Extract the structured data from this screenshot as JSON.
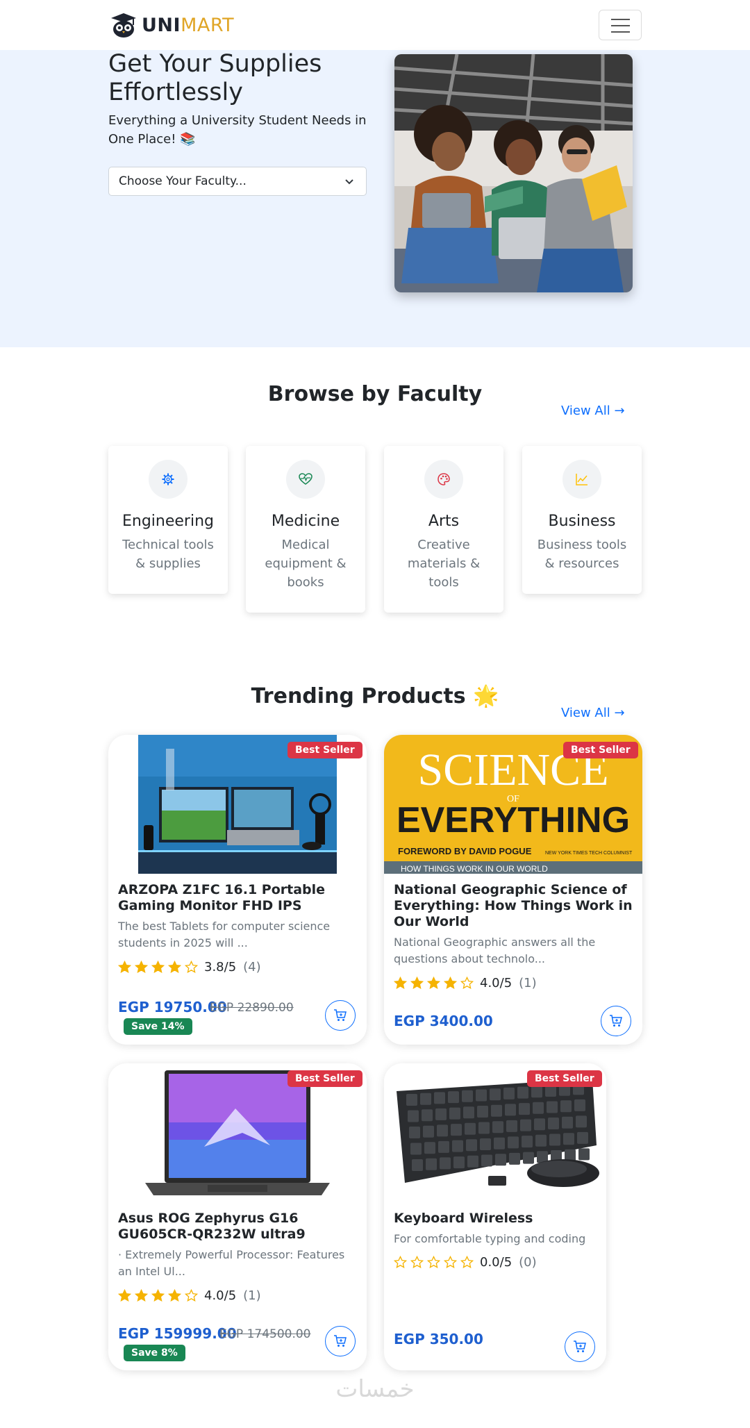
{
  "brand": {
    "part1": "UNI",
    "part2": "MART"
  },
  "hero": {
    "title": "Get Your Supplies Effortlessly",
    "subtitle": "Everything a University Student Needs in One Place! 📚",
    "faculty_select": "Choose Your Faculty..."
  },
  "faculty_section": {
    "title": "Browse by Faculty",
    "view_all": "View All →",
    "items": [
      {
        "name": "Engineering",
        "desc": "Technical tools & supplies",
        "icon": "gear-icon",
        "color": "#0d6efd"
      },
      {
        "name": "Medicine",
        "desc": "Medical equipment & books",
        "icon": "heart-pulse-icon",
        "color": "#198754"
      },
      {
        "name": "Arts",
        "desc": "Creative materials & tools",
        "icon": "palette-icon",
        "color": "#dc3545"
      },
      {
        "name": "Business",
        "desc": "Business tools & resources",
        "icon": "chart-line-icon",
        "color": "#ffc107"
      }
    ]
  },
  "trending": {
    "title": "Trending Products 🌟",
    "view_all": "View All →",
    "products": [
      {
        "badge": "Best Seller",
        "title": "ARZOPA Z1FC 16.1 Portable Gaming Monitor FHD IPS",
        "desc": "The best Tablets for computer science students in 2025 will ...",
        "rating": "3.8/5",
        "rating_value": 3.8,
        "count": "(4)",
        "price": "EGP 19750.00",
        "old_price": "EGP 22890.00",
        "save": "Save 14%"
      },
      {
        "badge": "Best Seller",
        "title": "National Geographic Science of Everything: How Things Work in Our World",
        "desc": "National Geographic answers all the questions about technolo...",
        "rating": "4.0/5",
        "rating_value": 4.0,
        "count": "(1)",
        "price": "EGP 3400.00",
        "cover_top": "SCIENCE",
        "cover_of": "OF",
        "cover_main": "EVERYTHING",
        "cover_foreword": "FOREWORD BY DAVID POGUE",
        "cover_columnist": "NEW YORK TIMES TECH COLUMNIST",
        "cover_tagline": "HOW THINGS WORK IN OUR WORLD"
      },
      {
        "badge": "Best Seller",
        "title": "Asus ROG Zephyrus G16 GU605CR-QR232W ultra9",
        "desc": "· Extremely Powerful Processor: Features an Intel Ul...",
        "rating": "4.0/5",
        "rating_value": 4.0,
        "count": "(1)",
        "price": "EGP 159999.00",
        "old_price": "EGP 174500.00",
        "save": "Save 8%"
      },
      {
        "badge": "Best Seller",
        "title": "Keyboard Wireless",
        "desc": "For comfortable typing and coding",
        "rating": "0.0/5",
        "rating_value": 0.0,
        "count": "(0)",
        "price": "EGP 350.00"
      }
    ]
  },
  "watermark": "خمسات",
  "colors": {
    "hero_bg": "#ecf3fe",
    "accent": "#0d6efd",
    "price": "#1e5fcf",
    "badge_red": "#dc3545",
    "badge_green": "#198754",
    "brand_gold": "#e0a526"
  }
}
